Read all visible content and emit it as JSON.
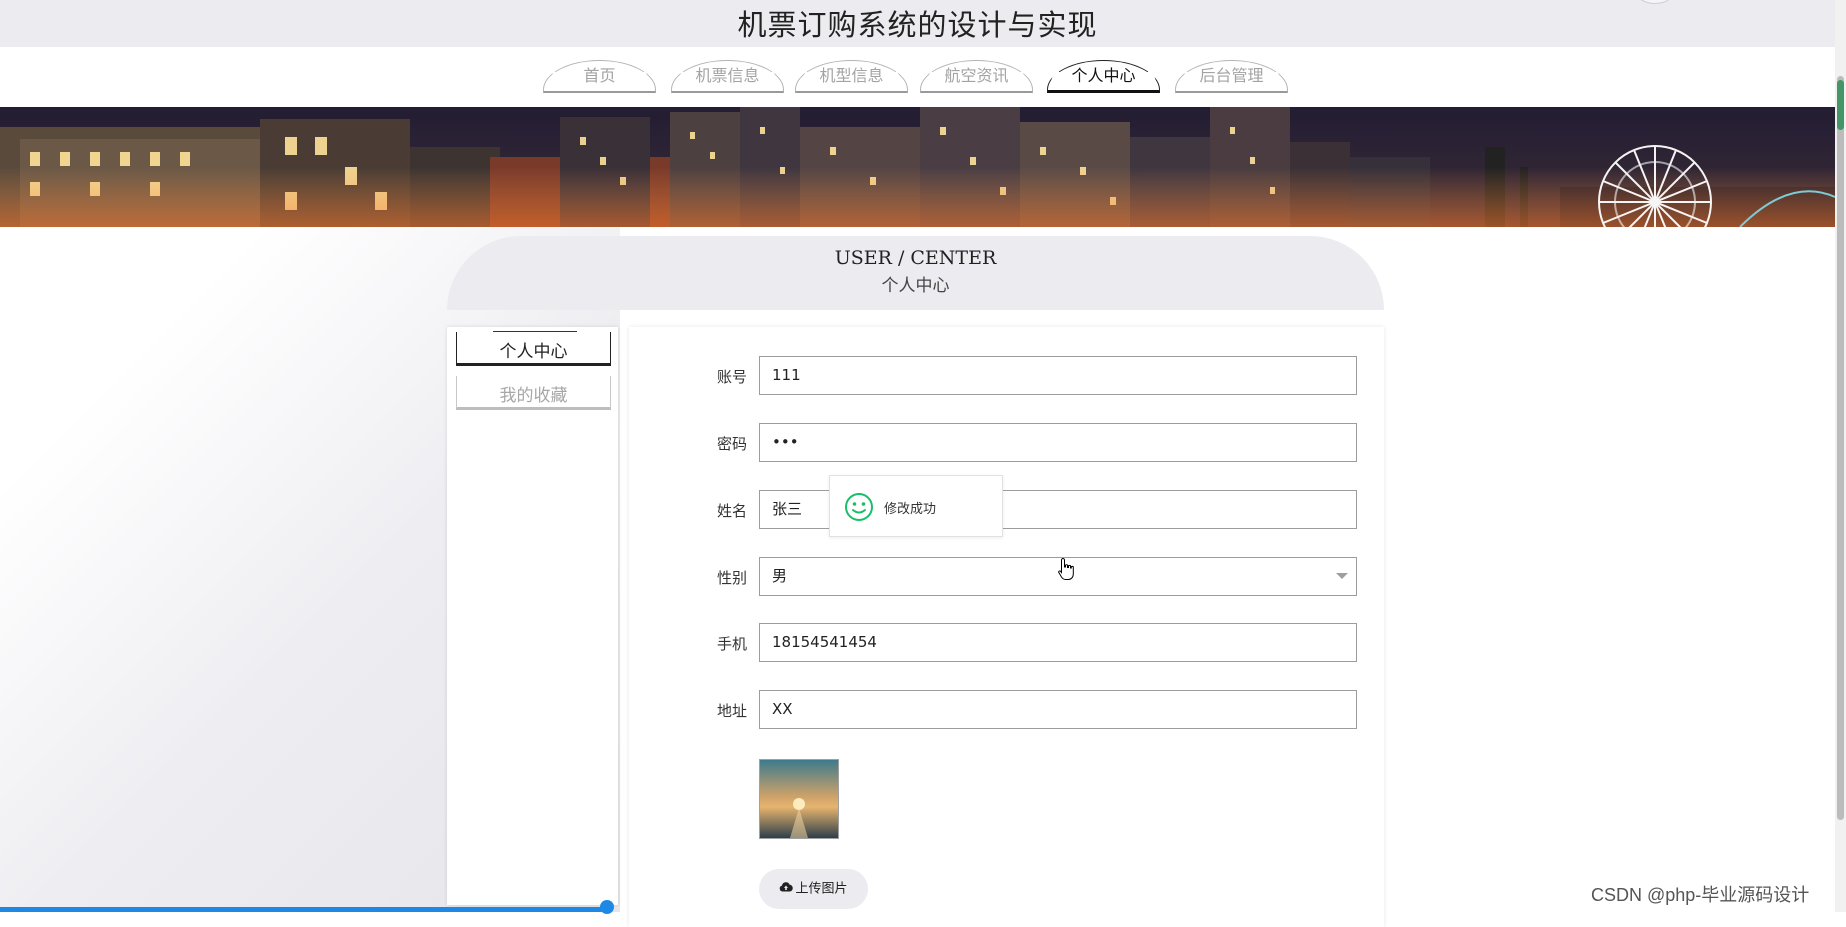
{
  "site": {
    "title": "机票订购系统的设计与实现"
  },
  "nav": {
    "tabs": [
      {
        "label": "首页",
        "active": false
      },
      {
        "label": "机票信息",
        "active": false
      },
      {
        "label": "机型信息",
        "active": false
      },
      {
        "label": "航空资讯",
        "active": false
      },
      {
        "label": "个人中心",
        "active": true
      },
      {
        "label": "后台管理",
        "active": false
      }
    ]
  },
  "section": {
    "title_en": "USER / CENTER",
    "title_cn": "个人中心"
  },
  "sidebar": {
    "items": [
      {
        "label": "个人中心",
        "active": true
      },
      {
        "label": "我的收藏",
        "active": false
      }
    ]
  },
  "form": {
    "account": {
      "label": "账号",
      "value": "111"
    },
    "password": {
      "label": "密码",
      "value": "•••"
    },
    "name": {
      "label": "姓名",
      "value": "张三"
    },
    "gender": {
      "label": "性别",
      "value": "男"
    },
    "phone": {
      "label": "手机",
      "value": "18154541454"
    },
    "address": {
      "label": "地址",
      "value": "XX"
    },
    "upload_label": "上传图片"
  },
  "toast": {
    "message": "修改成功",
    "icon": "smile-icon",
    "color": "#19be6b"
  },
  "watermark": "CSDN @php-毕业源码设计",
  "colors": {
    "nav_active": "#111111",
    "progress": "#1e88e5",
    "toast_icon": "#19be6b"
  }
}
